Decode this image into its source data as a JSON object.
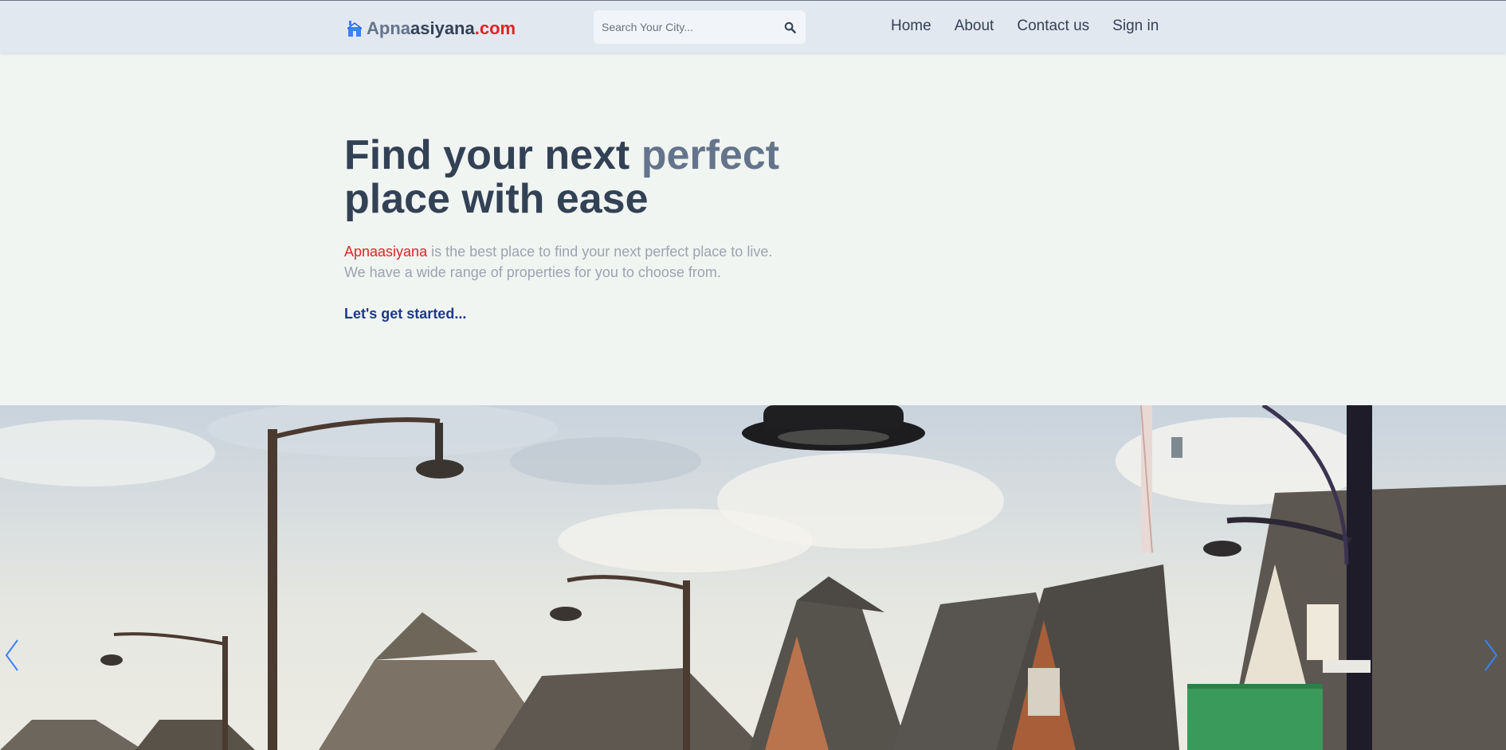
{
  "header": {
    "logo": {
      "icon": "home-icon",
      "part1": "Apna",
      "part2": "asiyana",
      "part3": ".com"
    },
    "search": {
      "placeholder": "Search Your City...",
      "value": "",
      "icon": "search-icon"
    },
    "nav": [
      {
        "label": "Home"
      },
      {
        "label": "About"
      },
      {
        "label": "Contact us"
      },
      {
        "label": "Sign in"
      }
    ]
  },
  "hero": {
    "title_part1": "Find your next ",
    "title_accent": "perfect",
    "title_part2": "place with ease",
    "desc_brand": "Apnaasiyana",
    "desc_line1_rest": " is the best place to find your next perfect place to live.",
    "desc_line2": "We have a wide range of properties for you to choose from.",
    "cta": "Let's get started..."
  },
  "slider": {
    "image": "suburban-houses-with-street-lamps",
    "prev_icon": "chevron-left-icon",
    "next_icon": "chevron-right-icon"
  },
  "colors": {
    "header_bg": "#e2e8f0",
    "page_bg": "#f1f5f2",
    "brand_red": "#dc2626",
    "text_dark": "#334155",
    "text_muted": "#64748b",
    "cta_blue": "#1e3a8a",
    "arrow_blue": "#3b82f6"
  }
}
